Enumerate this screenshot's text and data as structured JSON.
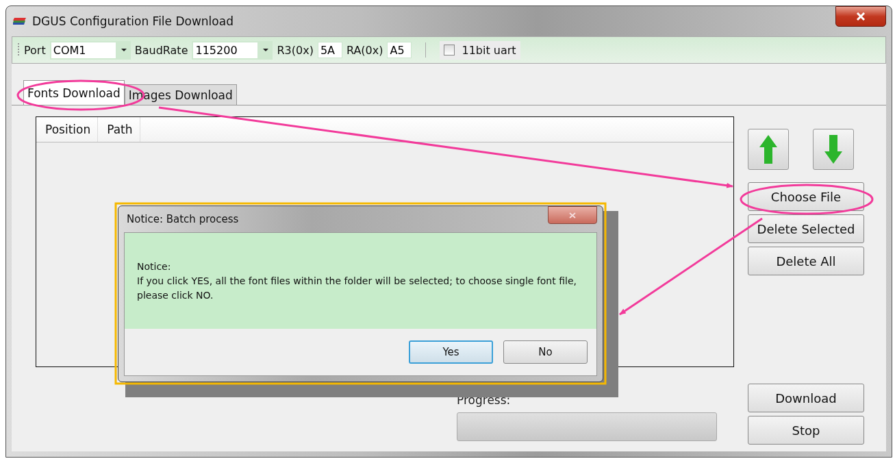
{
  "window": {
    "title": "DGUS Configuration File Download"
  },
  "toolbar": {
    "port_label": "Port",
    "port_value": "COM1",
    "baudrate_label": "BaudRate",
    "baudrate_value": "115200",
    "r3_label": "R3(0x)",
    "r3_value": "5A",
    "ra_label": "RA(0x)",
    "ra_value": "A5",
    "uart": {
      "label": "11bit uart",
      "checked": false
    }
  },
  "tabs": [
    {
      "label": "Fonts Download",
      "selected": true
    },
    {
      "label": "Images Download",
      "selected": false
    }
  ],
  "table": {
    "columns": [
      "Position",
      "Path"
    ]
  },
  "side_buttons": [
    "Choose File",
    "Delete Selected",
    "Delete All"
  ],
  "progress": {
    "label": "Progress:",
    "level": 0
  },
  "action_buttons": [
    "Download",
    "Stop"
  ],
  "dialog": {
    "title": "Notice: Batch process",
    "heading": "Notice:",
    "message": "If you click YES, all the font files within the folder will be selected; to choose single font file, please click NO.",
    "buttons": [
      {
        "label": "Yes",
        "default": true
      },
      {
        "label": "No",
        "default": false
      }
    ]
  }
}
